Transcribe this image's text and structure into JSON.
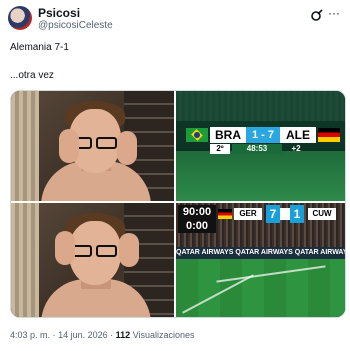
{
  "author": {
    "display_name": "Psicosi",
    "handle": "@psicosiCeleste"
  },
  "tweet": {
    "line1": "Alemania 7-1",
    "line2": "...otra vez"
  },
  "media": {
    "top_right_scoreboard": {
      "team_left": "BRA",
      "score": "1 - 7",
      "team_right": "ALE",
      "half": "2º",
      "clock": "48:53",
      "extra_time": "+2"
    },
    "bottom_right_scoreboard": {
      "time_main": "90:00",
      "time_extra": "0:00",
      "team_left": "GER",
      "score_left": "7",
      "score_right": "1",
      "team_right": "CUW",
      "ad_text": "QATAR AIRWAYS   QATAR AIRWAYS   QATAR AIRWAYS   QATAR AIRWAYS"
    }
  },
  "footer": {
    "time": "4:03 p. m.",
    "separator": "·",
    "date": "14 jun. 2026",
    "views_count": "112",
    "views_label": "Visualizaciones"
  },
  "icons": {
    "grok": "grok-icon",
    "more": "more-icon"
  },
  "colors": {
    "text_primary": "#0f1419",
    "text_secondary": "#536471",
    "score_blue": "#2aa7e0"
  }
}
